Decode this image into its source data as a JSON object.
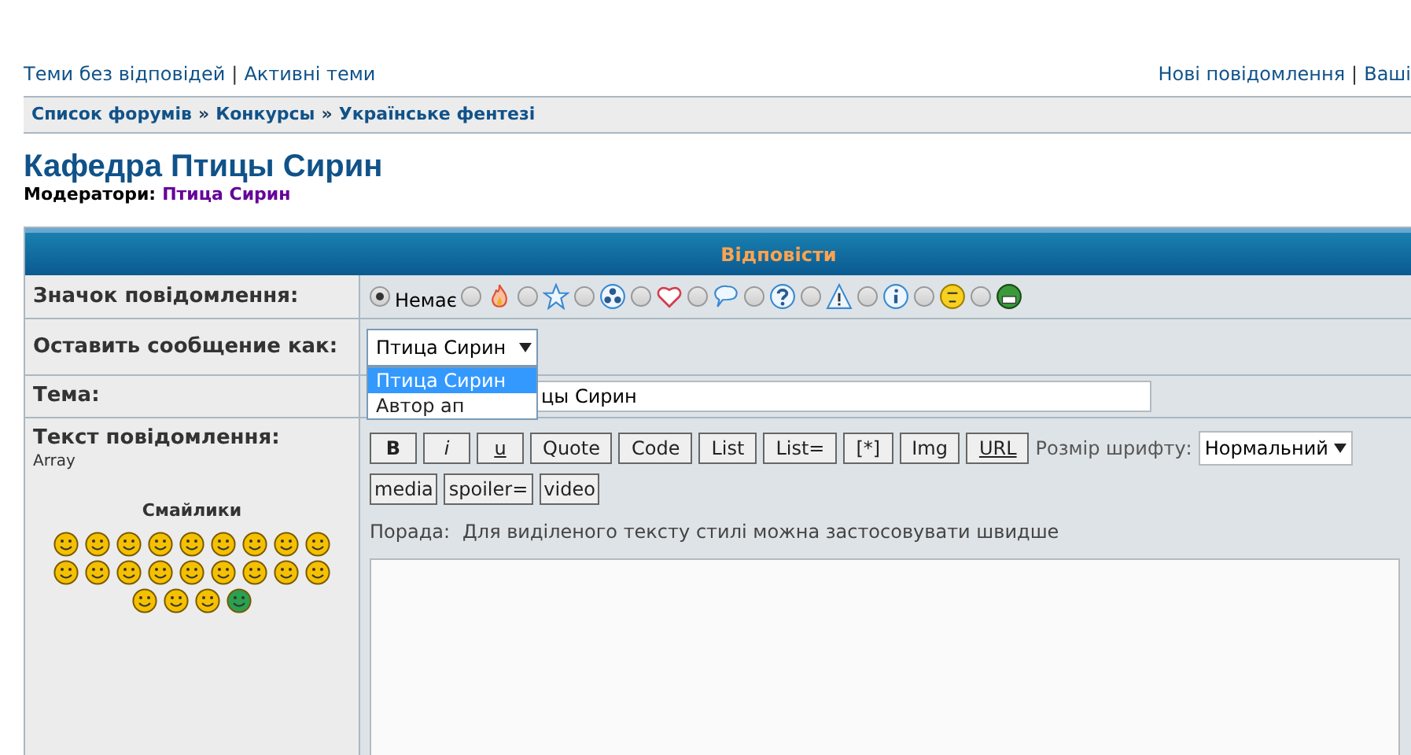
{
  "top_links": {
    "left": [
      {
        "kind": "link",
        "label": "Теми без відповідей"
      },
      {
        "kind": "separator",
        "label": "|"
      },
      {
        "kind": "link",
        "label": "Активні теми"
      }
    ],
    "right": [
      {
        "kind": "link",
        "label": "Нові повідомлення"
      },
      {
        "kind": "separator",
        "label": "|"
      },
      {
        "kind": "link",
        "label": "Ваші"
      }
    ]
  },
  "breadcrumbs": [
    {
      "kind": "link",
      "label": "Список форумів"
    },
    {
      "kind": "separator",
      "label": "»"
    },
    {
      "kind": "link",
      "label": "Конкурсы"
    },
    {
      "kind": "separator",
      "label": "»"
    },
    {
      "kind": "link",
      "label": "Українське фентезі"
    }
  ],
  "forum": {
    "title": "Кафедра Птицы Сирин",
    "moderators_label": "Модератори:",
    "moderator": "Птица Сирин"
  },
  "form": {
    "title": "Відповісти",
    "post_icon": {
      "label": "Значок повідомлення:",
      "options": [
        {
          "kind": "none",
          "label": "Немає",
          "selected": true
        },
        {
          "kind": "fire",
          "selected": false
        },
        {
          "kind": "star",
          "selected": false
        },
        {
          "kind": "radiation",
          "selected": false
        },
        {
          "kind": "heart",
          "selected": false
        },
        {
          "kind": "speech",
          "selected": false
        },
        {
          "kind": "question",
          "selected": false
        },
        {
          "kind": "warning",
          "selected": false
        },
        {
          "kind": "info",
          "selected": false
        },
        {
          "kind": "face",
          "selected": false
        },
        {
          "kind": "grin",
          "selected": false
        }
      ]
    },
    "post_as": {
      "label": "Оставить сообщение как:",
      "value": "Птица Сирин",
      "expanded": true,
      "options": [
        {
          "label": "Птица Сирин",
          "selected": true
        },
        {
          "label": "Автор ап",
          "selected": false
        }
      ]
    },
    "subject": {
      "label": "Тема:",
      "value": "цы Сирин"
    },
    "message": {
      "label": "Текст повідомлення:",
      "note": "Array",
      "smilies_title": "Смайлики",
      "buttons": [
        {
          "label": "B",
          "kind": "bold"
        },
        {
          "label": "i",
          "kind": "italic"
        },
        {
          "label": "u",
          "kind": "underline"
        },
        {
          "label": "Quote",
          "kind": "plain"
        },
        {
          "label": "Code",
          "kind": "plain"
        },
        {
          "label": "List",
          "kind": "plain"
        },
        {
          "label": "List=",
          "kind": "plain"
        },
        {
          "label": "[*]",
          "kind": "plain"
        },
        {
          "label": "Img",
          "kind": "plain"
        },
        {
          "label": "URL",
          "kind": "underline"
        }
      ],
      "font_size_label": "Розмір шрифту:",
      "font_size": "Нормальний",
      "extra_buttons": [
        {
          "label": "media"
        },
        {
          "label": "spoiler="
        },
        {
          "label": "video"
        }
      ],
      "hint_label": "Порада:",
      "hint": "Для виділеного тексту стилі можна застосовувати швидше"
    }
  }
}
